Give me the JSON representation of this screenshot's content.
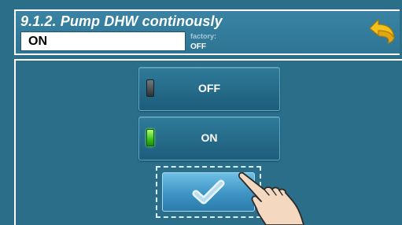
{
  "header": {
    "title": "9.1.2. Pump DHW continously",
    "current_value": "ON",
    "factory_label": "factory:",
    "factory_value": "OFF"
  },
  "options": [
    {
      "label": "OFF",
      "indicator": "led-off-icon",
      "selected": false
    },
    {
      "label": "ON",
      "indicator": "led-on-icon",
      "selected": true
    }
  ],
  "icons": {
    "back": "back-arrow-icon",
    "confirm": "checkmark-icon",
    "pointer": "hand-pointer-icon"
  },
  "colors": {
    "background": "#2a6e8a",
    "button": "#1d5d7a",
    "led_on": "#38c21c",
    "back_arrow": "#f2c21b",
    "confirm_button": "#3d94c4"
  }
}
